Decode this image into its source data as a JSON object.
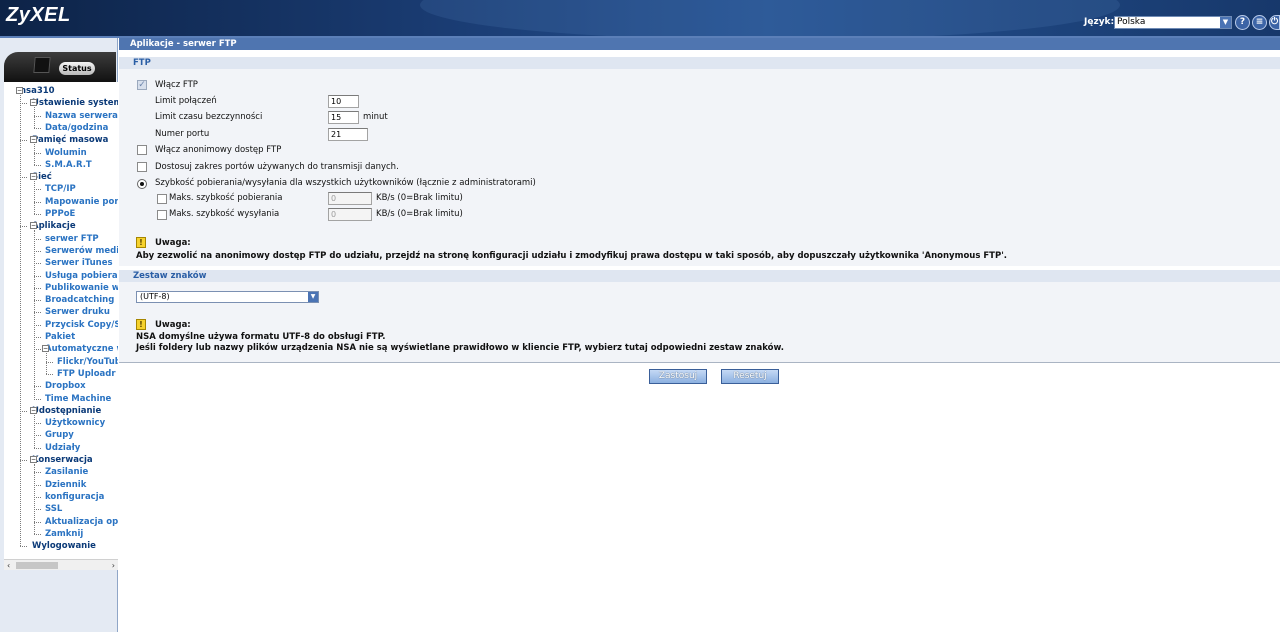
{
  "header": {
    "logo": "ZyXEL",
    "language_label": "Język:",
    "language_value": "Polska",
    "icons": [
      "help-icon",
      "site-map-icon",
      "logout-icon"
    ]
  },
  "sidebar": {
    "status_tab": "Status",
    "tree": [
      {
        "label": "nsa310",
        "level": 0
      },
      {
        "label": "Ustawienie systemu",
        "level": 1
      },
      {
        "label": "Nazwa serwera",
        "level": 2
      },
      {
        "label": "Data/godzina",
        "level": 2
      },
      {
        "label": "Pamięć masowa",
        "level": 1
      },
      {
        "label": "Wolumin",
        "level": 2
      },
      {
        "label": "S.M.A.R.T",
        "level": 2
      },
      {
        "label": "Sieć",
        "level": 1
      },
      {
        "label": "TCP/IP",
        "level": 2
      },
      {
        "label": "Mapowanie portów",
        "level": 2
      },
      {
        "label": "PPPoE",
        "level": 2
      },
      {
        "label": "Aplikacje",
        "level": 1
      },
      {
        "label": "serwer FTP",
        "level": 2
      },
      {
        "label": "Serwerów mediów",
        "level": 2
      },
      {
        "label": "Serwer iTunes",
        "level": 2
      },
      {
        "label": "Usługa pobierania",
        "level": 2
      },
      {
        "label": "Publikowanie w sieci",
        "level": 2
      },
      {
        "label": "Broadcatching",
        "level": 2
      },
      {
        "label": "Serwer druku",
        "level": 2
      },
      {
        "label": "Przycisk Copy/Sync",
        "level": 2
      },
      {
        "label": "Pakiet",
        "level": 2
      },
      {
        "label": "Automatyczne wysyłanie",
        "level": 2
      },
      {
        "label": "Flickr/YouTube",
        "level": 3
      },
      {
        "label": "FTP Uploadr",
        "level": 3
      },
      {
        "label": "Dropbox",
        "level": 2
      },
      {
        "label": "Time Machine",
        "level": 2
      },
      {
        "label": "Udostępnianie",
        "level": 1
      },
      {
        "label": "Użytkownicy",
        "level": 2
      },
      {
        "label": "Grupy",
        "level": 2
      },
      {
        "label": "Udziały",
        "level": 2
      },
      {
        "label": "Konserwacja",
        "level": 1
      },
      {
        "label": "Zasilanie",
        "level": 2
      },
      {
        "label": "Dziennik",
        "level": 2
      },
      {
        "label": "konfiguracja",
        "level": 2
      },
      {
        "label": "SSL",
        "level": 2
      },
      {
        "label": "Aktualizacja oprogramowania",
        "level": 2
      },
      {
        "label": "Zamknij",
        "level": 2
      },
      {
        "label": "Wylogowanie",
        "level": 1
      }
    ]
  },
  "main": {
    "page_title": "Aplikacje - serwer FTP",
    "ftp_section": "FTP",
    "enable_ftp": {
      "label": "Włącz FTP",
      "checked": true
    },
    "connection_limit": {
      "label": "Limit połączeń",
      "value": "10"
    },
    "idle_timeout": {
      "label": "Limit czasu bezczynności",
      "value": "15",
      "unit": "minut"
    },
    "port_number": {
      "label": "Numer portu",
      "value": "21"
    },
    "anonymous_access": {
      "label": "Włącz anonimowy dostęp FTP",
      "checked": false
    },
    "custom_port_range": {
      "label": "Dostosuj zakres portów używanych do transmisji danych.",
      "checked": false
    },
    "speed_all_users": {
      "label": "Szybkość pobierania/wysyłania dla wszystkich użytkowników (łącznie z administratorami)",
      "selected": true
    },
    "max_download": {
      "label": "Maks. szybkość pobierania",
      "value": "0",
      "unit": "KB/s (0=Brak limitu)"
    },
    "max_upload": {
      "label": "Maks. szybkość wysyłania",
      "value": "0",
      "unit": "KB/s (0=Brak limitu)"
    },
    "note1": {
      "title": "Uwaga:",
      "text": "Aby zezwolić na anonimowy dostęp FTP do udziału, przejdź na stronę konfiguracji udziału i zmodyfikuj prawa dostępu w taki sposób, aby dopuszczały użytkownika 'Anonymous FTP'."
    },
    "charset_section": "Zestaw znaków",
    "charset_value": "(UTF-8)",
    "note2": {
      "title": "Uwaga:",
      "line1": "NSA domyślne używa formatu UTF-8 do obsługi FTP.",
      "line2": "Jeśli foldery lub nazwy plików urządzenia NSA nie są wyświetlane prawidłowo w kliencie FTP, wybierz tutaj odpowiedni zestaw znaków."
    },
    "apply_button": "Zastosuj",
    "reset_button": "Resetuj"
  }
}
